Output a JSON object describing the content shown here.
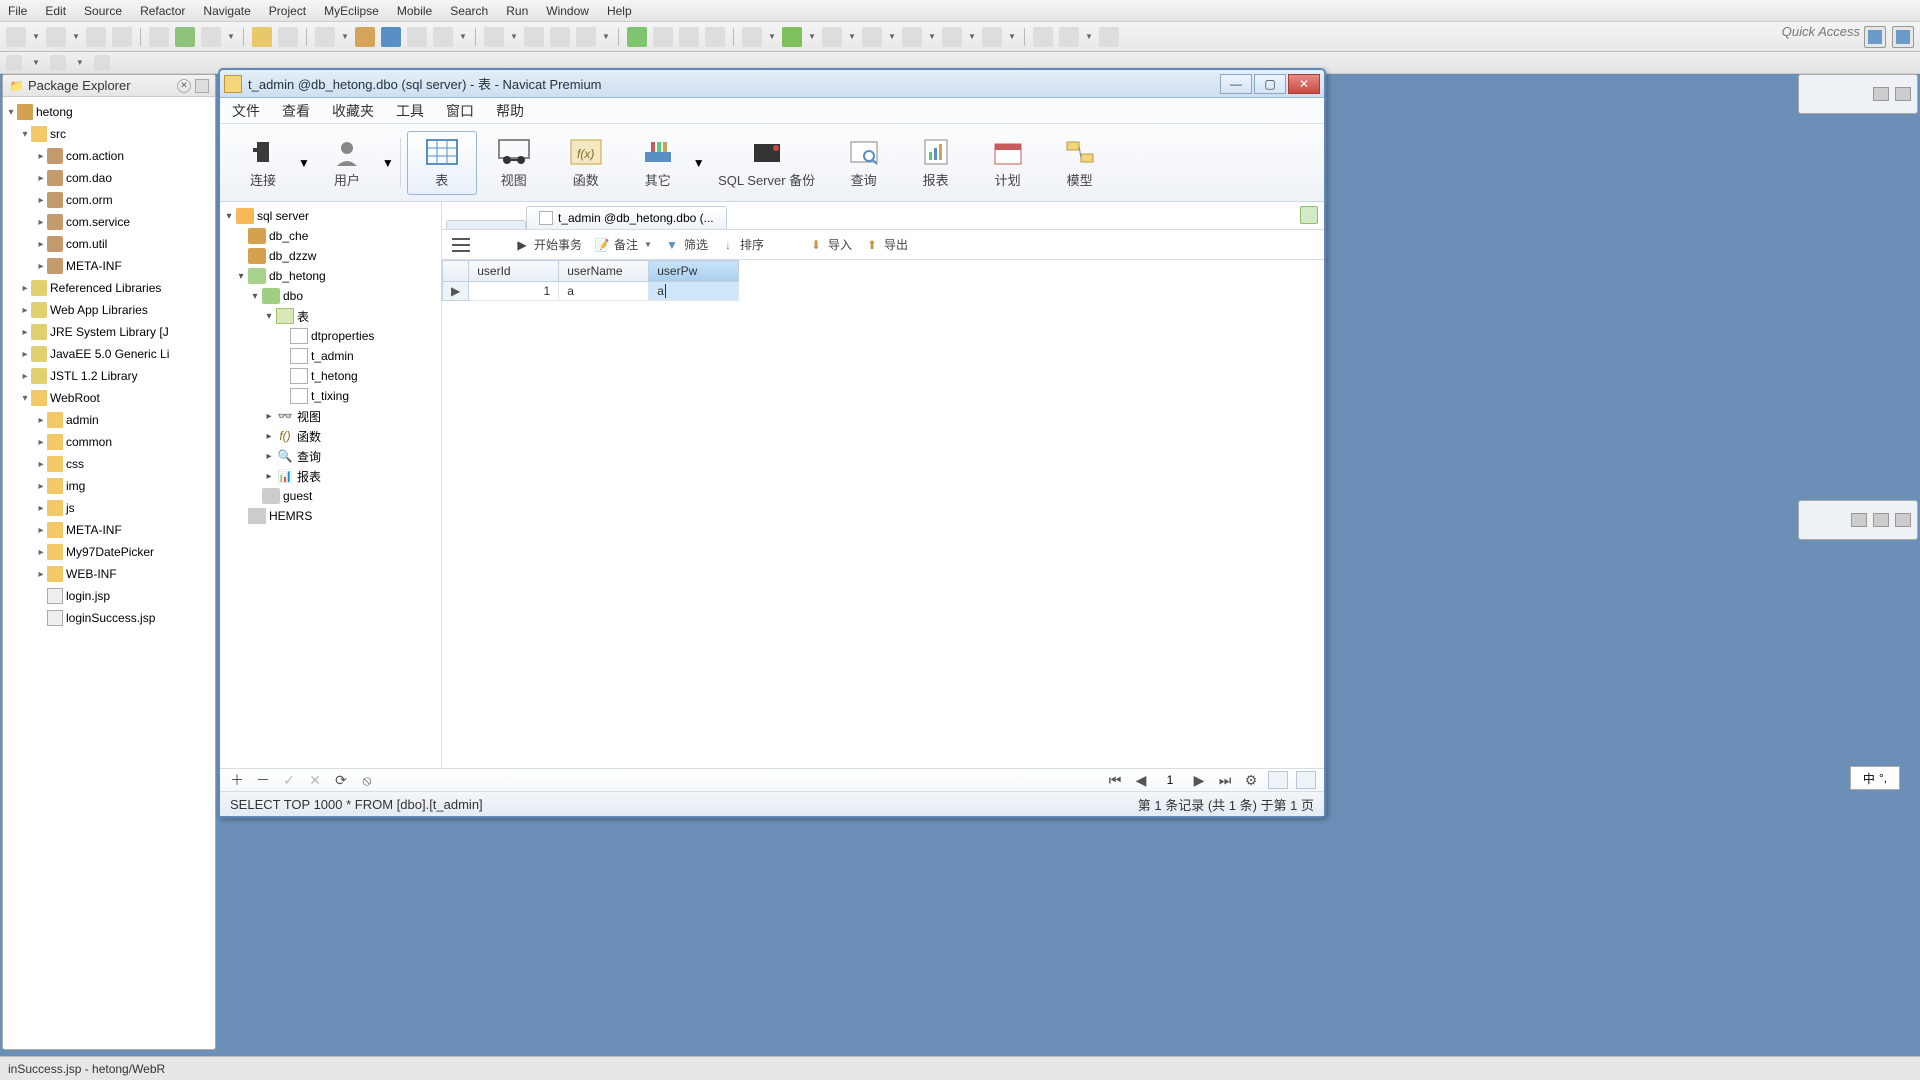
{
  "eclipse": {
    "menus": [
      "File",
      "Edit",
      "Source",
      "Refactor",
      "Navigate",
      "Project",
      "MyEclipse",
      "Mobile",
      "Search",
      "Run",
      "Window",
      "Help"
    ],
    "quick_access": "Quick Access",
    "status": "inSuccess.jsp - hetong/WebR",
    "package_explorer": {
      "title": "Package Explorer",
      "tree": {
        "project": "hetong",
        "src": "src",
        "packages": [
          "com.action",
          "com.dao",
          "com.orm",
          "com.service",
          "com.util",
          "META-INF"
        ],
        "libs": [
          "Referenced Libraries",
          "Web App Libraries",
          "JRE System Library [J",
          "JavaEE 5.0 Generic Li",
          "JSTL 1.2 Library"
        ],
        "webroot": "WebRoot",
        "webroot_children": [
          "admin",
          "common",
          "css",
          "img",
          "js",
          "META-INF",
          "My97DatePicker",
          "WEB-INF"
        ],
        "files": [
          "login.jsp",
          "loginSuccess.jsp"
        ]
      }
    }
  },
  "navicat": {
    "title": "t_admin @db_hetong.dbo (sql server) - 表 - Navicat Premium",
    "menus": [
      "文件",
      "查看",
      "收藏夹",
      "工具",
      "窗口",
      "帮助"
    ],
    "toolbar": [
      {
        "label": "连接",
        "drop": true
      },
      {
        "label": "用户",
        "drop": true
      },
      {
        "label": "表",
        "active": true
      },
      {
        "label": "视图"
      },
      {
        "label": "函数"
      },
      {
        "label": "其它",
        "drop": true
      },
      {
        "label": "SQL Server 备份"
      },
      {
        "label": "查询"
      },
      {
        "label": "报表"
      },
      {
        "label": "计划"
      },
      {
        "label": "模型"
      }
    ],
    "tree": {
      "server": "sql server",
      "dbs": [
        "db_che",
        "db_dzzw"
      ],
      "db_open": "db_hetong",
      "schema": "dbo",
      "tables_label": "表",
      "tables": [
        "dtproperties",
        "t_admin",
        "t_hetong",
        "t_tixing"
      ],
      "view": "视图",
      "func": "函数",
      "query": "查询",
      "report": "报表",
      "guest": "guest",
      "other_db": "HEMRS"
    },
    "tab_label": "t_admin @db_hetong.dbo (...",
    "data_toolbar": {
      "start_txn": "开始事务",
      "note": "备注",
      "filter": "筛选",
      "sort": "排序",
      "import": "导入",
      "export": "导出"
    },
    "grid": {
      "columns": [
        "userId",
        "userName",
        "userPw"
      ],
      "selected_col": 2,
      "rows": [
        {
          "userId": "1",
          "userName": "a",
          "userPw": "a"
        }
      ]
    },
    "pager": {
      "page": "1"
    },
    "status_sql": "SELECT TOP 1000  * FROM [dbo].[t_admin]",
    "status_right": "第 1 条记录 (共 1 条) 于第 1 页"
  },
  "ime": {
    "label": "中"
  }
}
